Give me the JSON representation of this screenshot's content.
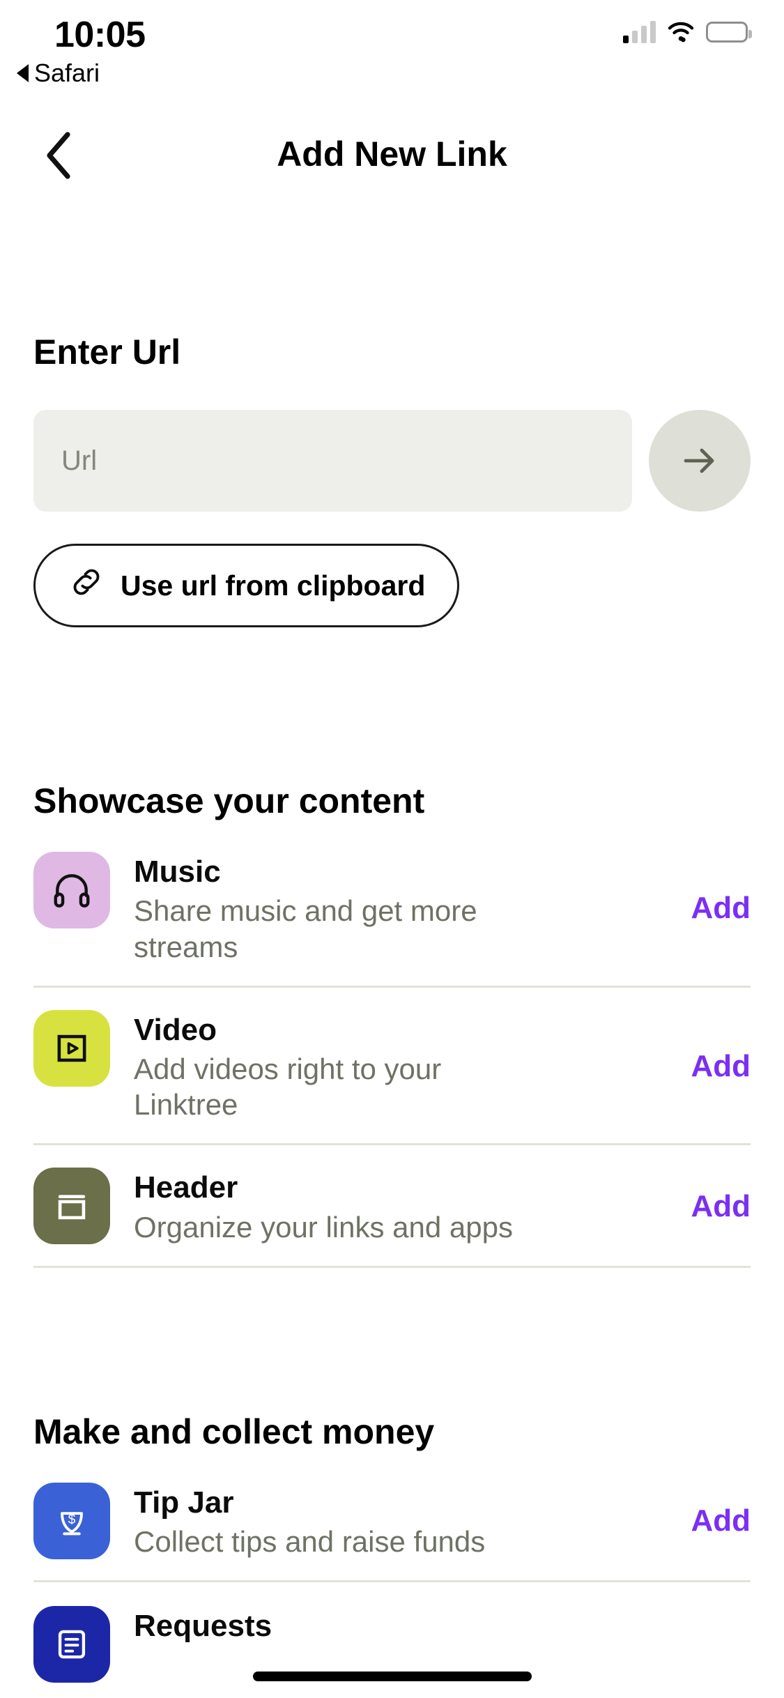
{
  "status_bar": {
    "time": "10:05",
    "back_app": "Safari",
    "cellular_icon": "cellular-signal-icon",
    "wifi_icon": "wifi-icon",
    "battery_icon": "battery-icon"
  },
  "nav": {
    "back_icon": "chevron-left-icon",
    "title": "Add New Link"
  },
  "url_section": {
    "heading": "Enter Url",
    "input_value": "",
    "input_placeholder": "Url",
    "submit_icon": "arrow-right-icon",
    "clipboard_label": "Use url from clipboard",
    "clipboard_icon": "link-chain-icon"
  },
  "sections": [
    {
      "heading": "Showcase your content",
      "items": [
        {
          "title": "Music",
          "desc": "Share music and get more streams",
          "action": "Add",
          "icon": "headphones-icon",
          "tile_color": "#DFB8E4",
          "icon_color": "#101010"
        },
        {
          "title": "Video",
          "desc": "Add videos right to your Linktree",
          "action": "Add",
          "icon": "video-play-icon",
          "tile_color": "#D7E241",
          "icon_color": "#101010"
        },
        {
          "title": "Header",
          "desc": "Organize your links and apps",
          "action": "Add",
          "icon": "header-layout-icon",
          "tile_color": "#6B6F4A",
          "icon_color": "#FFFFFF"
        }
      ]
    },
    {
      "heading": "Make and collect money",
      "items": [
        {
          "title": "Tip Jar",
          "desc": "Collect tips and raise funds",
          "action": "Add",
          "icon": "tip-jar-dollar-icon",
          "tile_color": "#3A62D6",
          "icon_color": "#FFFFFF"
        },
        {
          "title": "Requests",
          "desc": "",
          "action": "",
          "icon": "requests-icon",
          "tile_color": "#1C27A8",
          "icon_color": "#FFFFFF"
        }
      ]
    }
  ],
  "colors": {
    "accent_purple": "#7B2FF2",
    "input_bg": "#EEEEEA",
    "submit_bg": "#DEDFD6",
    "divider": "#E2E2D9",
    "desc_text": "#6E7265"
  },
  "home_indicator": "home-indicator"
}
